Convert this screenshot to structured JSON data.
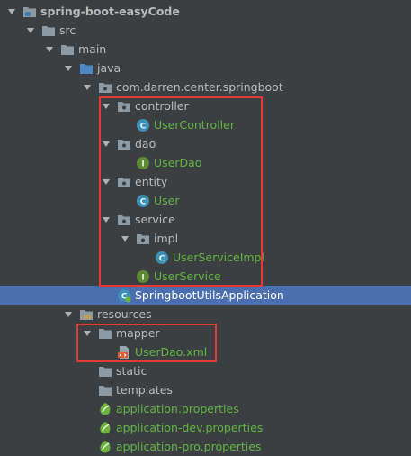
{
  "tree": {
    "project": "spring-boot-easyCode",
    "src": "src",
    "main": "main",
    "java": "java",
    "package": "com.darren.center.springboot",
    "controller": "controller",
    "user_controller": "UserController",
    "dao": "dao",
    "user_dao": "UserDao",
    "entity": "entity",
    "user": "User",
    "service": "service",
    "impl": "impl",
    "user_service_impl": "UserServiceImpl",
    "user_service": "UserService",
    "application_class": "SpringbootUtilsApplication",
    "resources": "resources",
    "mapper": "mapper",
    "user_dao_xml": "UserDao.xml",
    "static": "static",
    "templates": "templates",
    "app_props": "application.properties",
    "app_dev_props": "application-dev.properties",
    "app_pro_props": "application-pro.properties"
  },
  "icons": {
    "class": "class-icon",
    "interface": "interface-icon",
    "folder": "folder-icon",
    "package": "package-folder-icon",
    "resources": "resources-folder-icon",
    "xml": "xml-file-icon",
    "spring": "spring-properties-icon",
    "spring_boot_class": "spring-boot-class-icon"
  },
  "colors": {
    "background": "#3c3f41",
    "selection": "#4b6eaf",
    "text": "#bbbbbb",
    "vcs_added": "#62b543",
    "highlight_box": "#e53935",
    "class_icon": "#3d8fb4",
    "interface_icon": "#5c8a34",
    "folder_icon": "#8c9aa6"
  }
}
